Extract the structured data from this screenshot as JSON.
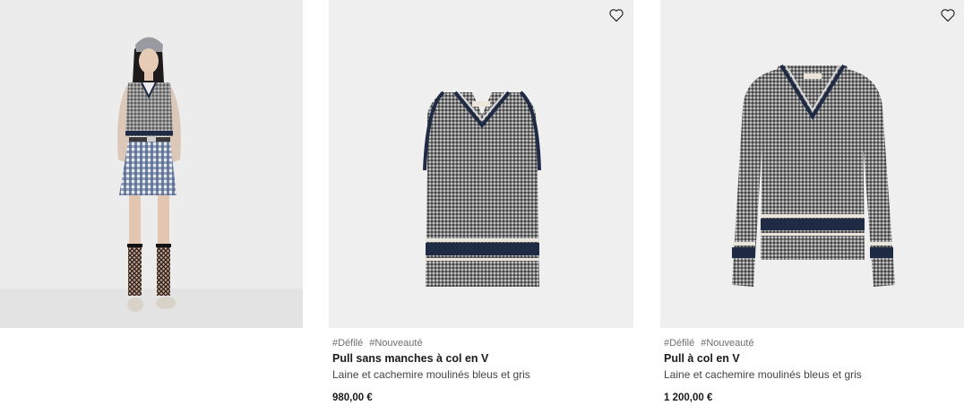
{
  "editorial": {
    "image": "model-runway-look"
  },
  "products": [
    {
      "tags": [
        "#Défilé",
        "#Nouveauté"
      ],
      "name": "Pull sans manches à col en V",
      "description": "Laine et cachemire moulinés bleus et gris",
      "price": "980,00 €",
      "image": "sleeveless-v-neck-sweater",
      "wishlist_icon": "heart-outline-icon"
    },
    {
      "tags": [
        "#Défilé",
        "#Nouveauté"
      ],
      "name": "Pull à col en V",
      "description": "Laine et cachemire moulinés bleus et gris",
      "price": "1 200,00 €",
      "image": "v-neck-sweater",
      "wishlist_icon": "heart-outline-icon"
    }
  ],
  "colors": {
    "knit_gray": "#7d7d7d",
    "navy_stripe": "#1f2a44",
    "background": "#efeff0"
  }
}
